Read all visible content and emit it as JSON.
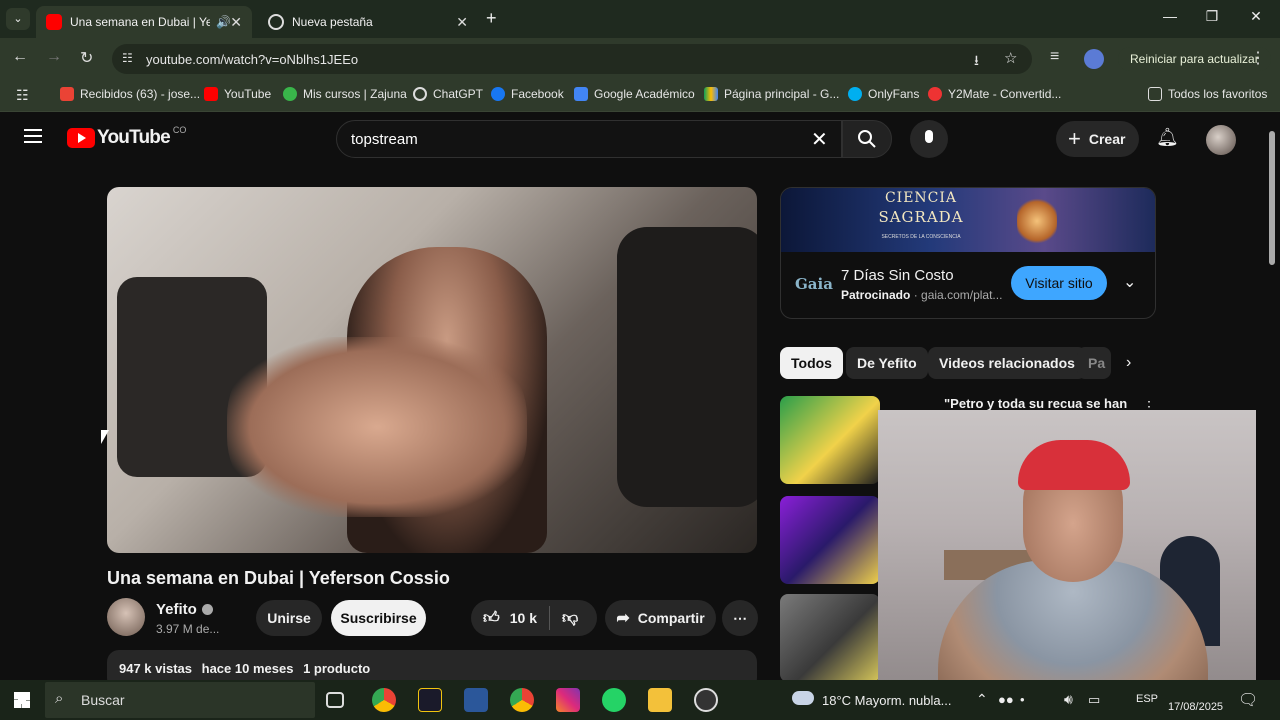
{
  "browser": {
    "tabs": [
      {
        "title": "Una semana en Dubai | Yef"
      },
      {
        "title": "Nueva pestaña"
      }
    ],
    "url": "youtube.com/watch?v=oNblhs1JEEo",
    "update_label": "Reiniciar para actualizar",
    "bookmarks": [
      {
        "label": "Recibidos (63) - jose..."
      },
      {
        "label": "YouTube"
      },
      {
        "label": "Mis cursos | Zajuna"
      },
      {
        "label": "ChatGPT"
      },
      {
        "label": "Facebook"
      },
      {
        "label": "Google Académico"
      },
      {
        "label": "Página principal - G..."
      },
      {
        "label": "OnlyFans"
      },
      {
        "label": "Y2Mate - Convertid..."
      }
    ],
    "all_bookmarks_label": "Todos los favoritos"
  },
  "youtube": {
    "logo_text": "YouTube",
    "country": "CO",
    "search_value": "topstream",
    "create_label": "Crear"
  },
  "video": {
    "title": "Una semana en Dubai | Yeferson Cossio",
    "channel_name": "Yefito",
    "subscribers": "3.97 M de...",
    "join_label": "Unirse",
    "subscribe_label": "Suscribirse",
    "likes": "10 k",
    "share_label": "Compartir",
    "views": "947 k vistas",
    "published": "hace 10 meses",
    "products": "1 producto"
  },
  "ad": {
    "banner_line1": "CIENCIA",
    "banner_line2": "SAGRADA",
    "banner_line3": "SECRETOS DE LA CONSCIENCIA",
    "brand": "Gaia",
    "headline": "7 Días Sin Costo",
    "sponsored": "Patrocinado",
    "domain": "gaia.com/plat...",
    "cta": "Visitar sitio"
  },
  "chips": [
    "Todos",
    "De Yefito",
    "Videos relacionados",
    "Pa"
  ],
  "related": [
    {
      "title": "\"Petro y toda su recua se han"
    }
  ],
  "taskbar": {
    "search_placeholder": "Buscar",
    "weather": "18°C  Mayorm. nubla...",
    "lang": "ESP",
    "date": "17/08/2025"
  },
  "colors": {
    "youtube_red": "#ff0000",
    "cta_blue": "#3ea6ff",
    "browser_green": "#2f3a2b"
  }
}
